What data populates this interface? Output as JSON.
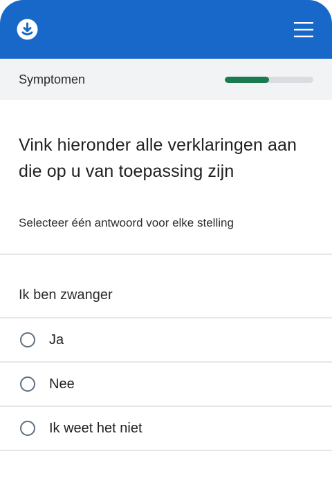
{
  "header": {
    "logo_icon": "download-circle-icon",
    "menu_icon": "hamburger-menu-icon",
    "background_color": "#1868c9"
  },
  "progress": {
    "section": "Symptomen",
    "fraction": 0.5,
    "fill_color": "#1b7a4f"
  },
  "question": {
    "title": "Vink hieronder alle verklaringen aan die op u van toepassing zijn",
    "instruction": "Selecteer één antwoord voor elke stelling"
  },
  "statements": [
    {
      "label": "Ik ben zwanger",
      "options": [
        {
          "label": "Ja"
        },
        {
          "label": "Nee"
        },
        {
          "label": "Ik weet het niet"
        }
      ]
    }
  ]
}
